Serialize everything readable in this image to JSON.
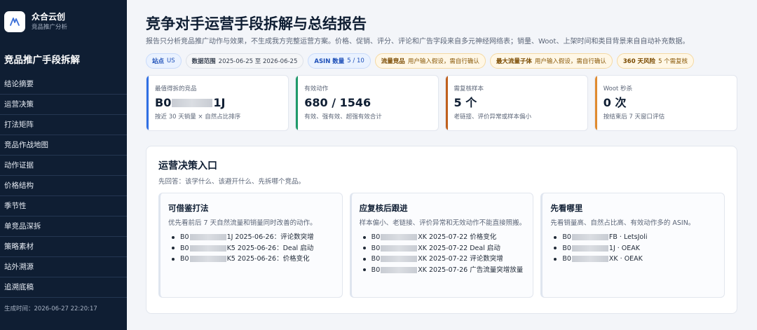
{
  "brand": {
    "name": "众合云创",
    "subtitle": "竞品推广分析"
  },
  "sidebar": {
    "title": "竞品推广手段拆解",
    "items": [
      {
        "label": "结论摘要"
      },
      {
        "label": "运营决策"
      },
      {
        "label": "打法矩阵"
      },
      {
        "label": "竞品作战地图"
      },
      {
        "label": "动作证据"
      },
      {
        "label": "价格结构"
      },
      {
        "label": "季节性"
      },
      {
        "label": "单竞品深拆"
      },
      {
        "label": "策略素材"
      },
      {
        "label": "站外溯源"
      },
      {
        "label": "追溯底稿"
      }
    ],
    "footer": "生成时间：2026-06-27 22:20:17"
  },
  "header": {
    "title": "竞争对手运营手段拆解与总结报告",
    "description": "报告只分析竞品推广动作与效果，不生成我方完整运营方案。价格、促销、评分、评论和广告字段来自多元神经网络表；销量、Woot、上架时间和类目背景来自自动补充数据。"
  },
  "chips": [
    {
      "key": "站点",
      "value": "US",
      "style": "blue"
    },
    {
      "key": "数据范围",
      "value": "2025-06-25 至 2026-06-25",
      "style": "gray"
    },
    {
      "key": "ASIN 数量",
      "value": "5 / 10",
      "style": "blue"
    },
    {
      "key": "流量竞品",
      "value": "用户输入假设，需自行确认",
      "style": "amber"
    },
    {
      "key": "最大流量子体",
      "value": "用户输入假设，需自行确认",
      "style": "amber"
    },
    {
      "key": "360 天风险",
      "value": "5 个需复核",
      "style": "amber"
    }
  ],
  "stats": [
    {
      "label": "最值得拆的竞品",
      "value_prefix": "B0",
      "value_suffix": "1J",
      "note": "按近 30 天销量 × 自然占比排序"
    },
    {
      "label": "有效动作",
      "value": "680 / 1546",
      "note": "有效、强有效、超强有效合计"
    },
    {
      "label": "需复核样本",
      "value": "5 个",
      "note": "老链接、评价异常或样本偏小"
    },
    {
      "label": "Woot 秒杀",
      "value": "0 次",
      "note": "按结束后 7 天窗口评估"
    }
  ],
  "section": {
    "title": "运营决策入口",
    "subtitle": "先回答：该学什么、该避开什么、先拆哪个竞品。",
    "cards": [
      {
        "title": "可借鉴打法",
        "desc": "优先看前后 7 天自然流量和销量同时改善的动作。",
        "items": [
          {
            "prefix": "B0",
            "suffix": "1J 2025-06-26：评论数突增"
          },
          {
            "prefix": "B0",
            "suffix": "K5 2025-06-26：Deal 启动"
          },
          {
            "prefix": "B0",
            "suffix": "K5 2025-06-26：价格变化"
          }
        ]
      },
      {
        "title": "应复核后跟进",
        "desc": "样本偏小、老链接、评价异常和无效动作不能直接照搬。",
        "items": [
          {
            "prefix": "B0",
            "suffix": "XK 2025-07-22 价格变化"
          },
          {
            "prefix": "B0",
            "suffix": "XK 2025-07-22 Deal 启动"
          },
          {
            "prefix": "B0",
            "suffix": "XK 2025-07-22 评论数突增"
          },
          {
            "prefix": "B0",
            "suffix": "XK 2025-07-26 广告流量突增放量"
          }
        ]
      },
      {
        "title": "先看哪里",
        "desc": "先看销量高、自然占比高、有效动作多的 ASIN。",
        "items": [
          {
            "prefix": "B0",
            "suffix": "FB · LetsJoli"
          },
          {
            "prefix": "B0",
            "suffix": "1J · OEAK"
          },
          {
            "prefix": "B0",
            "suffix": "XK · OEAK"
          }
        ]
      }
    ]
  }
}
